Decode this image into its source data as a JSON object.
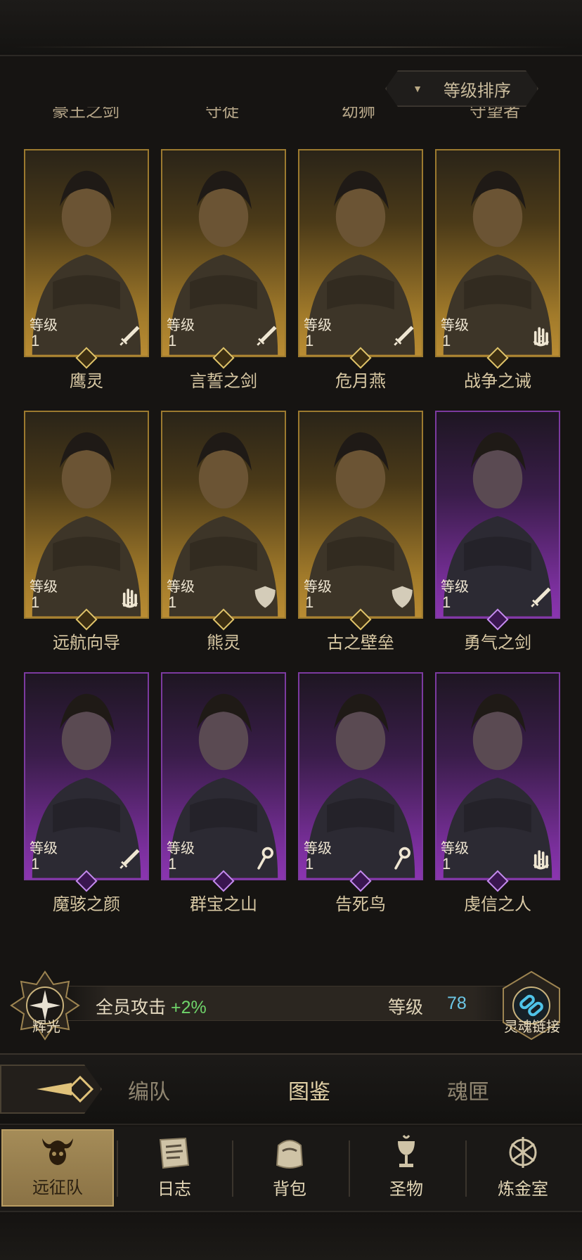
{
  "sort": {
    "label": "等级排序"
  },
  "top_cut_names": [
    "豪王之剑",
    "守徒",
    "幼狮",
    "守望者"
  ],
  "level_label": "等级",
  "heroes": [
    {
      "name": "鹰灵",
      "level": "1",
      "rarity": "gold",
      "role": "sword-icon"
    },
    {
      "name": "言誓之剑",
      "level": "1",
      "rarity": "gold",
      "role": "sword-icon"
    },
    {
      "name": "危月燕",
      "level": "1",
      "rarity": "gold",
      "role": "sword-icon"
    },
    {
      "name": "战争之诫",
      "level": "1",
      "rarity": "gold",
      "role": "hand-icon"
    },
    {
      "name": "远航向导",
      "level": "1",
      "rarity": "gold",
      "role": "hand-icon"
    },
    {
      "name": "熊灵",
      "level": "1",
      "rarity": "gold",
      "role": "shield-icon"
    },
    {
      "name": "古之壁垒",
      "level": "1",
      "rarity": "gold",
      "role": "shield-icon"
    },
    {
      "name": "勇气之剑",
      "level": "1",
      "rarity": "purple",
      "role": "sword-icon"
    },
    {
      "name": "魔骇之颜",
      "level": "1",
      "rarity": "purple",
      "role": "sword-icon"
    },
    {
      "name": "群宝之山",
      "level": "1",
      "rarity": "purple",
      "role": "staff-icon"
    },
    {
      "name": "告死鸟",
      "level": "1",
      "rarity": "purple",
      "role": "staff-icon"
    },
    {
      "name": "虔信之人",
      "level": "1",
      "rarity": "purple",
      "role": "hand-icon"
    }
  ],
  "bonus": {
    "left_label": "辉光",
    "attack_text": "全员攻击",
    "attack_value": "+2%",
    "level_label": "等级",
    "level_value": "78",
    "right_label": "灵魂链接"
  },
  "tabs": [
    "编队",
    "图鉴",
    "魂匣"
  ],
  "active_tab": "图鉴",
  "nav": [
    {
      "label": "远征队",
      "icon": "horned-skull-icon",
      "active": true
    },
    {
      "label": "日志",
      "icon": "scroll-icon",
      "active": false
    },
    {
      "label": "背包",
      "icon": "bag-icon",
      "active": false
    },
    {
      "label": "圣物",
      "icon": "chalice-icon",
      "active": false
    },
    {
      "label": "炼金室",
      "icon": "alchemy-icon",
      "active": false
    }
  ],
  "colors": {
    "gold_card": "#b98c33",
    "purple_card": "#8b35b0",
    "positive_value": "#6fd46a",
    "level_value": "#6cc7e6"
  }
}
